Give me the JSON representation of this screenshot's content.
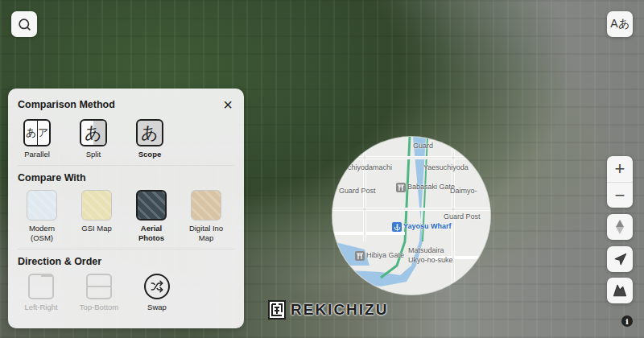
{
  "language_button": {
    "label": "Aあ"
  },
  "panel": {
    "close": "×",
    "sections": {
      "method": "Comparison Method",
      "compare": "Compare With",
      "direction": "Direction & Order"
    }
  },
  "comparison_methods": [
    {
      "label": "Parallel",
      "glyphs": [
        "あ",
        "ア"
      ],
      "selected": false,
      "kind": "parallel"
    },
    {
      "label": "Split",
      "glyphs": [
        "あ"
      ],
      "selected": false,
      "kind": "split"
    },
    {
      "label": "Scope",
      "glyphs": [
        "あ"
      ],
      "selected": true,
      "kind": "scope"
    }
  ],
  "compare_with": [
    {
      "label": "Modern (OSM)",
      "selected": false,
      "color": "#dfe9ef"
    },
    {
      "label": "GSI Map",
      "selected": false,
      "color": "#e9e1b6"
    },
    {
      "label": "Aerial Photos",
      "selected": true,
      "color": "#3e4c55"
    },
    {
      "label": "Digital Ino Map",
      "selected": false,
      "color": "#d8c4a4"
    }
  ],
  "direction": [
    {
      "label": "Left-Right",
      "disabled": true,
      "kind": "left-right"
    },
    {
      "label": "Top-Bottom",
      "disabled": true,
      "kind": "top-bottom"
    },
    {
      "label": "Swap",
      "disabled": false,
      "kind": "swap"
    }
  ],
  "scope_labels": [
    {
      "text": "Guard",
      "kind": "place"
    },
    {
      "text": "ochiyodamachi",
      "kind": "place"
    },
    {
      "text": "Yaesuchiyoda",
      "kind": "place"
    },
    {
      "text": "Guard Post",
      "kind": "place"
    },
    {
      "text": "Babasaki Gate",
      "kind": "gate"
    },
    {
      "text": "Daimyo-",
      "kind": "place"
    },
    {
      "text": "Guard Post",
      "kind": "place"
    },
    {
      "text": "Yayosu Wharf",
      "kind": "wharf"
    },
    {
      "text": "Matsudaira Ukyo-no-suke",
      "kind": "estate"
    },
    {
      "text": "Hibiya Gate",
      "kind": "gate"
    }
  ],
  "zoom": {
    "in": "+",
    "out": "−"
  },
  "info": "i",
  "logo": "REKICHIZU"
}
